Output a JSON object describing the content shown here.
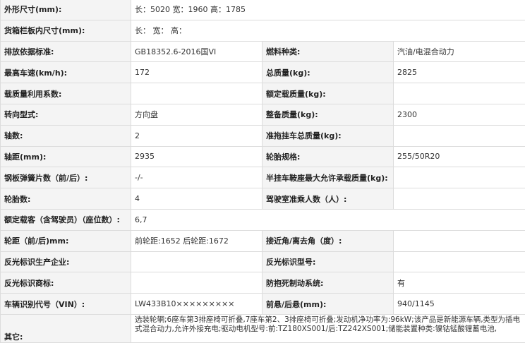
{
  "rows": [
    {
      "label": "外形尺寸(mm):",
      "value": "长：5020 宽：1960 高：1785"
    },
    {
      "label": "货箱栏板内尺寸(mm):",
      "value": "长： 宽： 高："
    },
    {
      "label": "排放依据标准:",
      "value": "GB18352.6-2016国VI",
      "label2": "燃料种类:",
      "value2": "汽油/电混合动力"
    },
    {
      "label": "最高车速(km/h):",
      "value": "172",
      "label2": "总质量(kg):",
      "value2": "2825"
    },
    {
      "label": "载质量利用系数:",
      "value": "",
      "label2": "额定载质量(kg):",
      "value2": ""
    },
    {
      "label": "转向型式:",
      "value": "方向盘",
      "label2": "整备质量(kg):",
      "value2": "2300"
    },
    {
      "label": "轴数:",
      "value": "2",
      "label2": "准拖挂车总质量(kg):",
      "value2": ""
    },
    {
      "label": "轴距(mm):",
      "value": "2935",
      "label2": "轮胎规格:",
      "value2": "255/50R20"
    },
    {
      "label": "钢板弹簧片数（前/后）:",
      "value": "-/-",
      "label2": "半挂车鞍座最大允许承载质量(kg):",
      "value2": ""
    },
    {
      "label": "轮胎数:",
      "value": "4",
      "label2": "驾驶室准乘人数（人）:",
      "value2": ""
    },
    {
      "label": "额定载客（含驾驶员）（座位数）:",
      "value": "6,7"
    },
    {
      "label": "轮距（前/后)mm:",
      "value": "前轮距:1652 后轮距:1672",
      "label2": "接近角/离去角（度）:",
      "value2": ""
    },
    {
      "label": "反光标识生产企业:",
      "value": "",
      "label2": "反光标识型号:",
      "value2": ""
    },
    {
      "label": "反光标识商标:",
      "value": "",
      "label2": "防抱死制动系统:",
      "value2": "有"
    },
    {
      "label": "车辆识别代号（VIN）:",
      "value": "LW433B10×××××××××",
      "label2": "前悬/后悬(mm):",
      "value2": "940/1145"
    }
  ],
  "other": {
    "label": "其它:",
    "text": "选装轮辋;6座车第3排座椅可折叠,7座车第2、3排座椅可折叠;发动机净功率为:96kW;该产品是新能源车辆,类型为插电式混合动力,允许外接充电;驱动电机型号:前:TZ180XS001/后:TZ242XS001;储能装置种类:镍钴锰酸锂蓄电池,"
  }
}
